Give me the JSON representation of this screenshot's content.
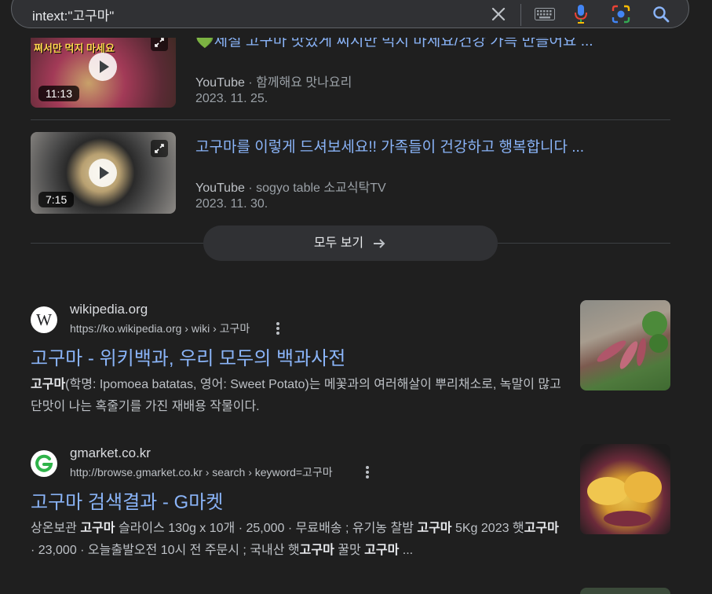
{
  "search": {
    "query": "intext:\"고구마\""
  },
  "videos": [
    {
      "title": "💚제철 고구마 맛있게 찌지만 먹지 마세요/건강 가득 만들어요 ...",
      "thumb_caption": "쪄서만 먹지 마세요",
      "duration": "11:13",
      "source": "YouTube",
      "channel": "함께해요 맛나요리",
      "date": "2023. 11. 25."
    },
    {
      "title": "고구마를 이렇게 드셔보세요!! 가족들이 건강하고 행복합니다 ...",
      "duration": "7:15",
      "source": "YouTube",
      "channel": "sogyo table 소교식탁TV",
      "date": "2023. 11. 30."
    }
  ],
  "see_all": "모두 보기",
  "results": [
    {
      "site": "wikipedia.org",
      "url": "https://ko.wikipedia.org › wiki › 고구마",
      "title": "고구마 - 위키백과, 우리 모두의 백과사전",
      "snippet": [
        {
          "b": "고구마"
        },
        {
          "t": "(학명: Ipomoea batatas, 영어: Sweet Potato)는 메꽃과의 여러해살이 뿌리채소로, 녹말이 많고 단맛이 나는 혹줄기를 가진 재배용 작물이다."
        }
      ],
      "favicon": "W"
    },
    {
      "site": "gmarket.co.kr",
      "url": "http://browse.gmarket.co.kr › search › keyword=고구마",
      "title": "고구마 검색결과 - G마켓",
      "snippet": [
        {
          "t": "상온보관 "
        },
        {
          "b": "고구마"
        },
        {
          "t": " 슬라이스 130g x 10개 · 25,000 · 무료배송 ; 유기농 찰밤 "
        },
        {
          "b": "고구마"
        },
        {
          "t": " 5Kg 2023 햇"
        },
        {
          "b": "고구마"
        },
        {
          "t": " · 23,000 · 오늘출발오전 10시 전 주문시 ; 국내산 햇"
        },
        {
          "b": "고구마"
        },
        {
          "t": " 꿀맛 "
        },
        {
          "b": "고구마"
        },
        {
          "t": " ..."
        }
      ],
      "favicon": "G"
    }
  ],
  "colors": {
    "background": "#1f1f1f",
    "link": "#8ab4f8",
    "text": "#bdc1c6"
  }
}
